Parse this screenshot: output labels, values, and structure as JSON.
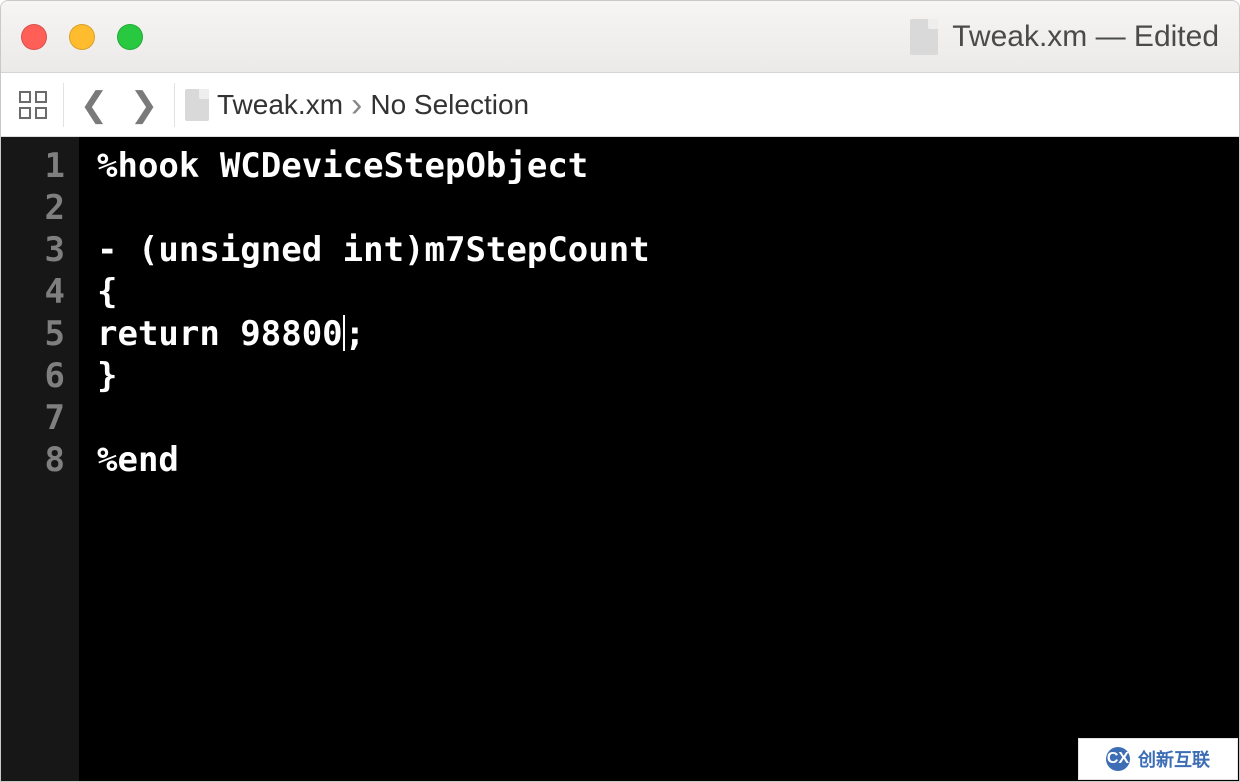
{
  "window": {
    "title": "Tweak.xm — Edited"
  },
  "toolbar": {
    "grid_icon": "related-items-icon",
    "back_icon": "chevron-left",
    "forward_icon": "chevron-right"
  },
  "breadcrumb": {
    "file": "Tweak.xm",
    "selection": "No Selection"
  },
  "editor": {
    "lines": [
      "%hook WCDeviceStepObject",
      "",
      "- (unsigned int)m7StepCount",
      "{",
      "return 98800;",
      "}",
      "",
      "%end"
    ],
    "cursor_line_index": 4,
    "cursor_col": 12
  },
  "watermark": {
    "text": "创新互联"
  }
}
